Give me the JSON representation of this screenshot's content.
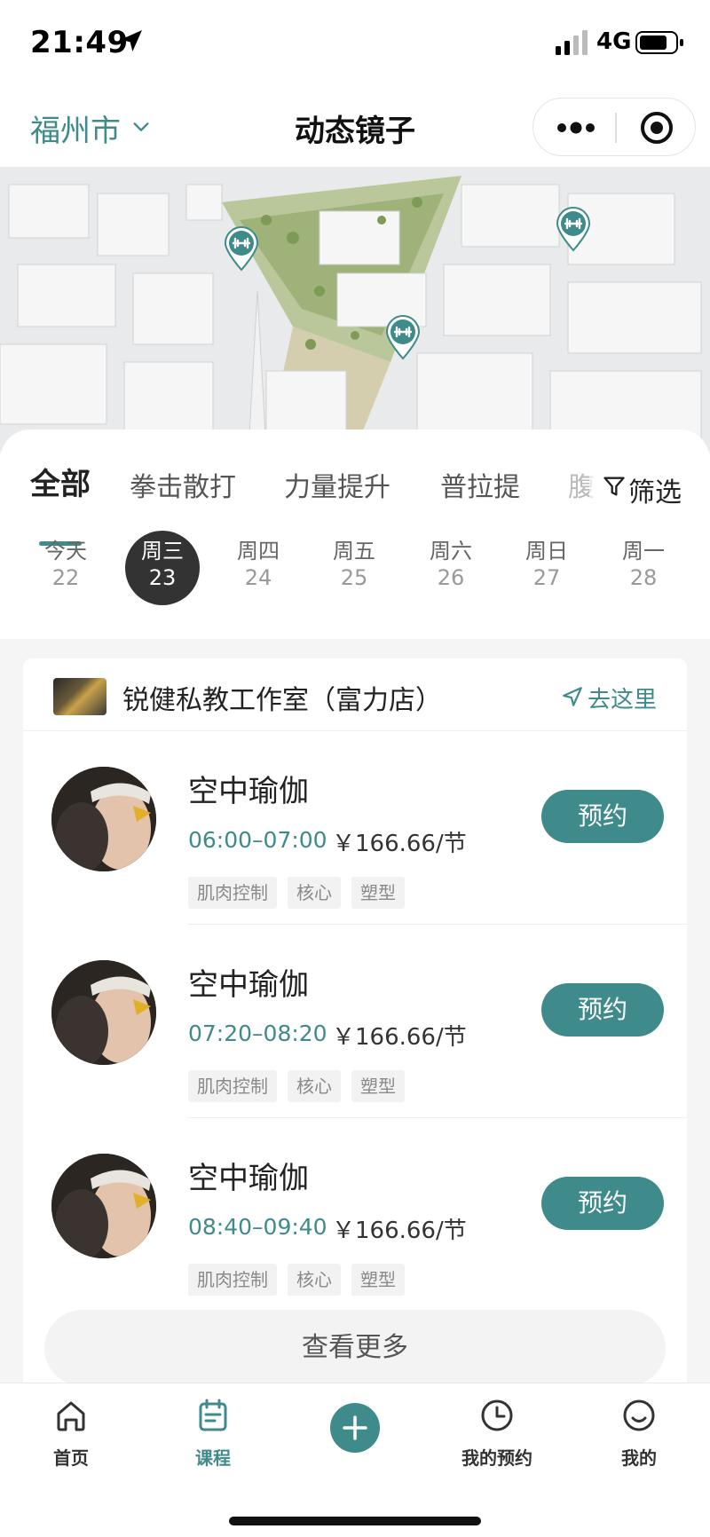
{
  "status_bar": {
    "time": "21:49",
    "network": "4G"
  },
  "nav": {
    "city": "福州市",
    "title": "动态镜子"
  },
  "categories": {
    "items": [
      "全部",
      "拳击散打",
      "力量提升",
      "普拉提",
      "腹"
    ],
    "active_index": 0,
    "filter_label": "筛选"
  },
  "days": [
    {
      "name": "今天",
      "date": "22"
    },
    {
      "name": "周三",
      "date": "23",
      "selected": true
    },
    {
      "name": "周四",
      "date": "24"
    },
    {
      "name": "周五",
      "date": "25"
    },
    {
      "name": "周六",
      "date": "26"
    },
    {
      "name": "周日",
      "date": "27"
    },
    {
      "name": "周一",
      "date": "28"
    }
  ],
  "store": {
    "name": "锐健私教工作室（富力店）",
    "go_label": "去这里"
  },
  "classes": [
    {
      "name": "空中瑜伽",
      "time": "06:00–07:00",
      "price": "￥166.66/节",
      "tags": [
        "肌肉控制",
        "核心",
        "塑型"
      ],
      "button": "预约"
    },
    {
      "name": "空中瑜伽",
      "time": "07:20–08:20",
      "price": "￥166.66/节",
      "tags": [
        "肌肉控制",
        "核心",
        "塑型"
      ],
      "button": "预约"
    },
    {
      "name": "空中瑜伽",
      "time": "08:40–09:40",
      "price": "￥166.66/节",
      "tags": [
        "肌肉控制",
        "核心",
        "塑型"
      ],
      "button": "预约"
    }
  ],
  "view_more": "查看更多",
  "tabbar": {
    "items": [
      {
        "label": "首页",
        "icon": "home-icon"
      },
      {
        "label": "课程",
        "icon": "calendar-icon",
        "active": true
      },
      {
        "label": "",
        "icon": "plus-icon"
      },
      {
        "label": "我的预约",
        "icon": "clock-icon"
      },
      {
        "label": "我的",
        "icon": "smiley-icon"
      }
    ]
  },
  "colors": {
    "accent": "#3f8a8a",
    "selected_day_bg": "#333333"
  }
}
